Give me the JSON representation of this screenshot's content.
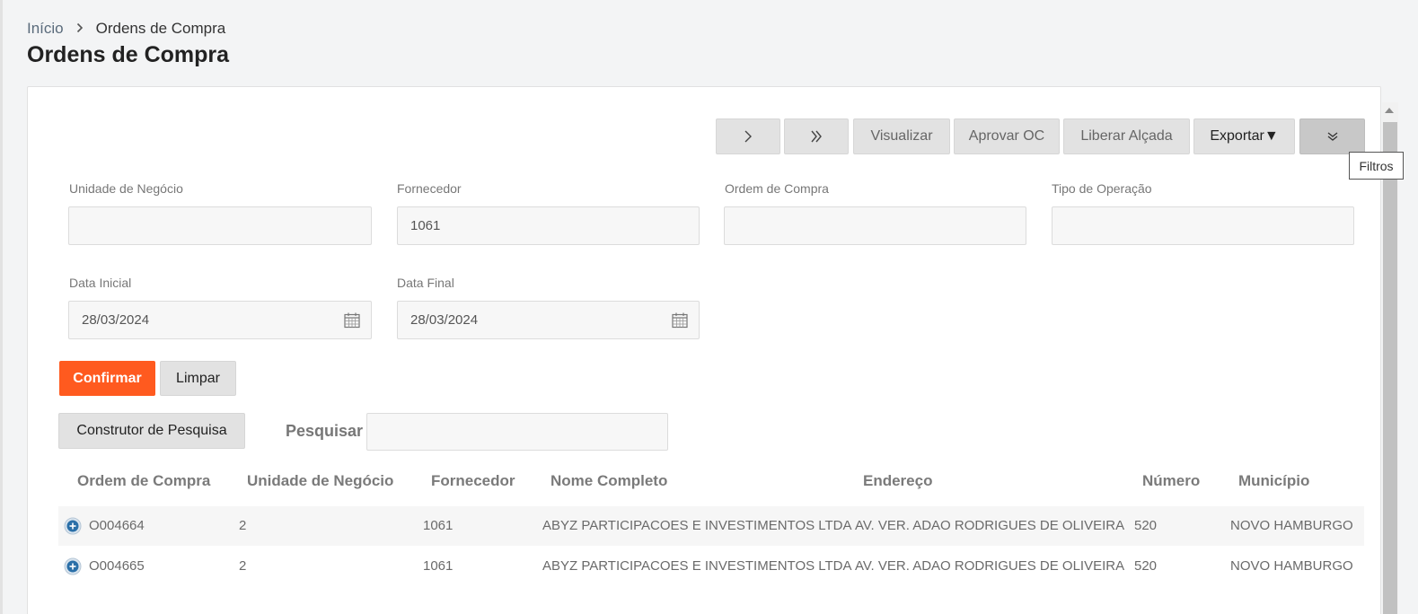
{
  "breadcrumb": {
    "home": "Início",
    "current": "Ordens de Compra"
  },
  "page_title": "Ordens de Compra",
  "toolbar": {
    "next_label": "›",
    "last_label": "»",
    "view_label": "Visualizar",
    "approve_label": "Aprovar OC",
    "release_label": "Liberar Alçada",
    "export_label": "Exportar▼",
    "filter_tooltip": "Filtros"
  },
  "filters": {
    "business_unit": {
      "label": "Unidade de Negócio",
      "value": ""
    },
    "supplier": {
      "label": "Fornecedor",
      "value": "1061"
    },
    "purchase_order": {
      "label": "Ordem de Compra",
      "value": ""
    },
    "operation_type": {
      "label": "Tipo de Operação",
      "value": ""
    },
    "start_date": {
      "label": "Data Inicial",
      "value": "28/03/2024"
    },
    "end_date": {
      "label": "Data Final",
      "value": "28/03/2024"
    }
  },
  "actions": {
    "confirm_label": "Confirmar",
    "clear_label": "Limpar",
    "query_builder_label": "Construtor de Pesquisa",
    "search_label": "Pesquisar",
    "search_value": ""
  },
  "table": {
    "headers": [
      "Ordem de Compra",
      "Unidade de Negócio",
      "Fornecedor",
      "Nome Completo",
      "Endereço",
      "Número",
      "Município"
    ],
    "rows": [
      [
        "O004664",
        "2",
        "1061",
        "ABYZ PARTICIPACOES E INVESTIMENTOS LTDA",
        "AV. VER. ADAO RODRIGUES DE OLIVEIRA",
        "520",
        "NOVO HAMBURGO"
      ],
      [
        "O004665",
        "2",
        "1061",
        "ABYZ PARTICIPACOES E INVESTIMENTOS LTDA",
        "AV. VER. ADAO RODRIGUES DE OLIVEIRA",
        "520",
        "NOVO HAMBURGO"
      ]
    ]
  },
  "colors": {
    "primary": "#ff5a1f",
    "icon_blue": "#2a6fa8"
  }
}
